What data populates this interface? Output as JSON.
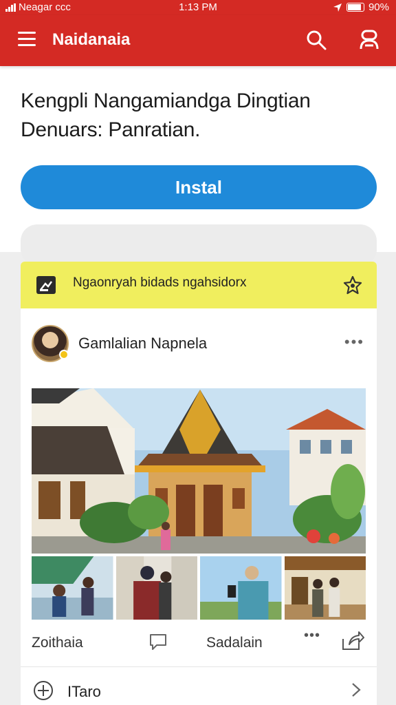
{
  "status_bar": {
    "carrier": "Neagar ccc",
    "time": "1:13 PM",
    "battery": "90%",
    "battery_level": 0.9
  },
  "app_bar": {
    "title": "Naidanaia",
    "icons": [
      "menu-icon",
      "search-icon",
      "account-icon"
    ]
  },
  "promo": {
    "headline": "Kengpli Nangamiandga Dingtian Denuars: Panratian.",
    "install_label": "Instal"
  },
  "banner": {
    "text": "Ngaonryah bidads ngahsidorx",
    "icons": [
      "flag-icon",
      "star-badge-icon"
    ]
  },
  "post": {
    "author": "Gamlalian Napnela",
    "more": "•••",
    "actions": {
      "first_label": "Zoithaia",
      "second_label": "Sadalain",
      "dots": "•••"
    },
    "bottom_row": {
      "label": "ITaro"
    }
  },
  "colors": {
    "app_bar": "#d42a24",
    "install_button": "#1f8ad9",
    "banner": "#f0ee5e",
    "feed_background": "#eeeeee"
  }
}
